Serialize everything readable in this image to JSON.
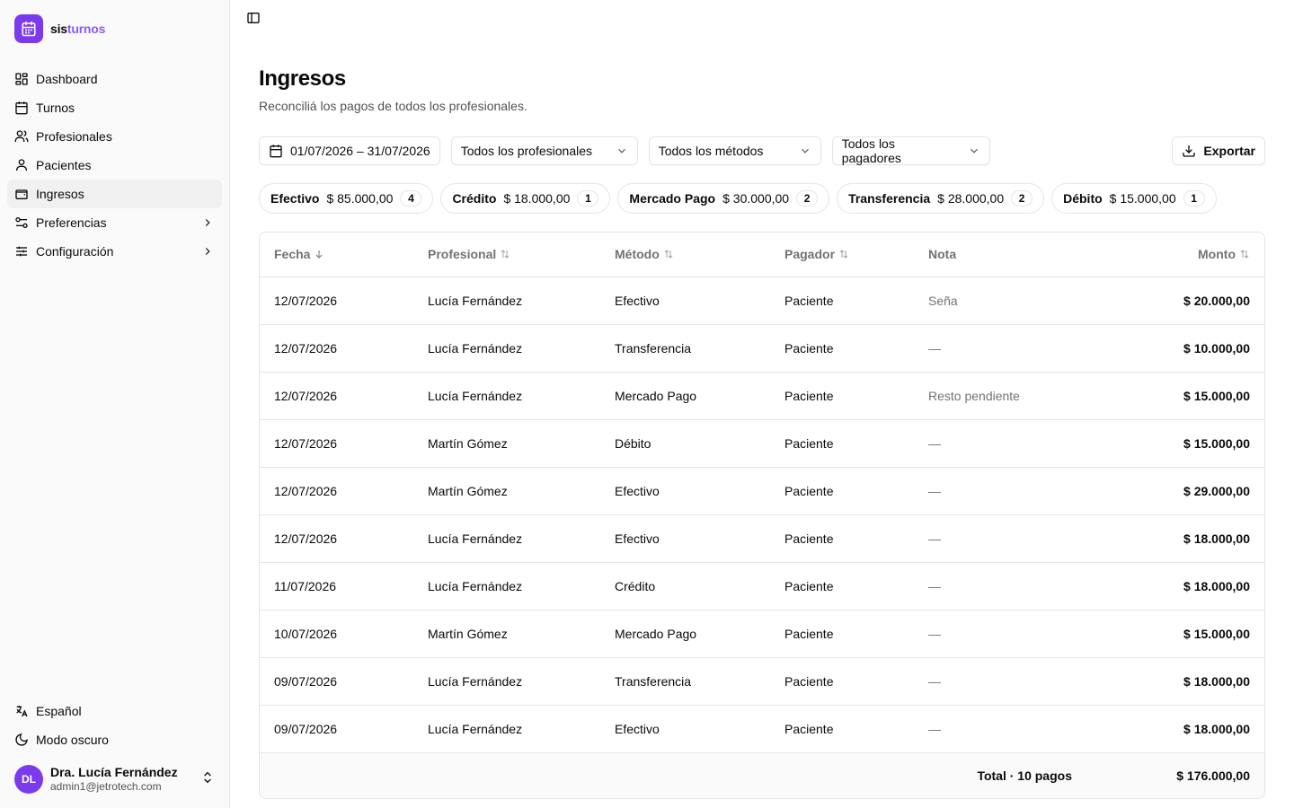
{
  "brand": {
    "part1": "sis",
    "part2": "turnos"
  },
  "nav": {
    "items": [
      {
        "label": "Dashboard"
      },
      {
        "label": "Turnos"
      },
      {
        "label": "Profesionales"
      },
      {
        "label": "Pacientes"
      },
      {
        "label": "Ingresos"
      },
      {
        "label": "Preferencias"
      },
      {
        "label": "Configuración"
      }
    ],
    "language": "Español",
    "dark_mode": "Modo oscuro"
  },
  "user": {
    "initials": "DL",
    "name": "Dra. Lucía Fernández",
    "email": "admin1@jetrotech.com"
  },
  "page": {
    "title": "Ingresos",
    "subtitle": "Reconciliá los pagos de todos los profesionales."
  },
  "filters": {
    "date_range": "01/07/2026 – 31/07/2026",
    "professional": "Todos los profesionales",
    "method": "Todos los métodos",
    "payer": "Todos los pagadores",
    "export": "Exportar"
  },
  "summary": [
    {
      "label": "Efectivo",
      "amount": "$ 85.000,00",
      "count": "4"
    },
    {
      "label": "Crédito",
      "amount": "$ 18.000,00",
      "count": "1"
    },
    {
      "label": "Mercado Pago",
      "amount": "$ 30.000,00",
      "count": "2"
    },
    {
      "label": "Transferencia",
      "amount": "$ 28.000,00",
      "count": "2"
    },
    {
      "label": "Débito",
      "amount": "$ 15.000,00",
      "count": "1"
    }
  ],
  "table": {
    "headers": {
      "date": "Fecha",
      "professional": "Profesional",
      "method": "Método",
      "payer": "Pagador",
      "note": "Nota",
      "amount": "Monto"
    },
    "rows": [
      {
        "date": "12/07/2026",
        "professional": "Lucía Fernández",
        "method": "Efectivo",
        "payer": "Paciente",
        "note": "Seña",
        "amount": "$ 20.000,00"
      },
      {
        "date": "12/07/2026",
        "professional": "Lucía Fernández",
        "method": "Transferencia",
        "payer": "Paciente",
        "note": "—",
        "amount": "$ 10.000,00"
      },
      {
        "date": "12/07/2026",
        "professional": "Lucía Fernández",
        "method": "Mercado Pago",
        "payer": "Paciente",
        "note": "Resto pendiente",
        "amount": "$ 15.000,00"
      },
      {
        "date": "12/07/2026",
        "professional": "Martín Gómez",
        "method": "Débito",
        "payer": "Paciente",
        "note": "—",
        "amount": "$ 15.000,00"
      },
      {
        "date": "12/07/2026",
        "professional": "Martín Gómez",
        "method": "Efectivo",
        "payer": "Paciente",
        "note": "—",
        "amount": "$ 29.000,00"
      },
      {
        "date": "12/07/2026",
        "professional": "Lucía Fernández",
        "method": "Efectivo",
        "payer": "Paciente",
        "note": "—",
        "amount": "$ 18.000,00"
      },
      {
        "date": "11/07/2026",
        "professional": "Lucía Fernández",
        "method": "Crédito",
        "payer": "Paciente",
        "note": "—",
        "amount": "$ 18.000,00"
      },
      {
        "date": "10/07/2026",
        "professional": "Martín Gómez",
        "method": "Mercado Pago",
        "payer": "Paciente",
        "note": "—",
        "amount": "$ 15.000,00"
      },
      {
        "date": "09/07/2026",
        "professional": "Lucía Fernández",
        "method": "Transferencia",
        "payer": "Paciente",
        "note": "—",
        "amount": "$ 18.000,00"
      },
      {
        "date": "09/07/2026",
        "professional": "Lucía Fernández",
        "method": "Efectivo",
        "payer": "Paciente",
        "note": "—",
        "amount": "$ 18.000,00"
      }
    ],
    "total_label": "Total · 10 pagos",
    "total_amount": "$ 176.000,00"
  },
  "colors": {
    "accent": "#7c3aed",
    "accent_light": "#8b5cf6",
    "border": "#e5e5e5",
    "muted": "#737373"
  }
}
